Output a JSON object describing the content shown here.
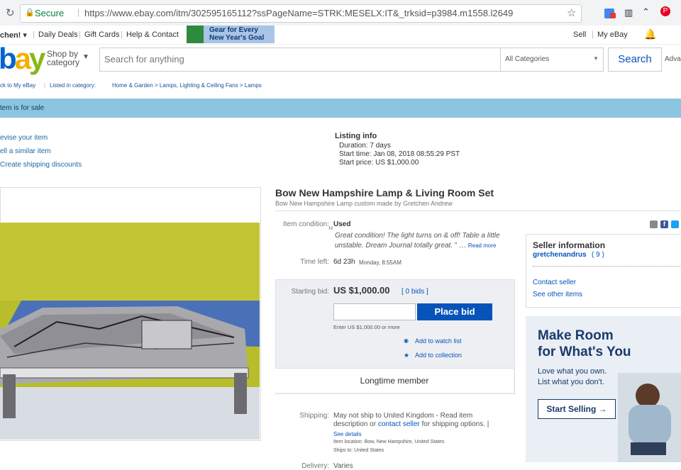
{
  "browser": {
    "secure_label": "Secure",
    "url": "https://www.ebay.com/itm/302595165112?ssPageName=STRK:MESELX:IT&_trksid=p3984.m1558.l2649"
  },
  "topnav": {
    "user": "chen! ▾",
    "links": [
      "Daily Deals",
      "Gift Cards",
      "Help & Contact"
    ],
    "gear_banner": [
      "Gear for Every",
      "New Year's Goal"
    ],
    "right_links": [
      "Sell",
      "My eBay"
    ]
  },
  "header": {
    "logo": "bay",
    "shop_by": [
      "Shop by",
      "category"
    ],
    "search_placeholder": "Search for anything",
    "category": "All Categories",
    "search_button": "Search",
    "advanced": "Advan"
  },
  "breadcrumb": {
    "back": "ck to My eBay",
    "listed": "Listed in category:",
    "path": "Home & Garden > Lamps, Lighting & Ceiling Fans > Lamps"
  },
  "status_bar": "tem is for sale",
  "seller_links": [
    "evise your item",
    "ell a similar item",
    "Create shipping discounts"
  ],
  "listing_info": {
    "heading": "Listing info",
    "duration": "Duration:   7 days",
    "start_time": "Start time:  Jan 08, 2018 08:55:29 PST",
    "start_price": "Start price:  US $1,000.00"
  },
  "item": {
    "title": "Bow New Hampshire Lamp & Living Room Set",
    "subtitle": "Bow New Hampshire Lamp custom made by Gretchen Andrew",
    "condition_label": "Item condition:",
    "condition_value": "Used",
    "condition_note": "Great condition! The light turns on & off! Table a little unstable. Dream Journal totally great.",
    "read_more": "Read more",
    "time_left_label": "Time left:",
    "time_left_value": "6d 23h",
    "time_left_day": "Monday, 8:55AM",
    "starting_bid_label": "Starting bid:",
    "starting_bid_value": "US $1,000.00",
    "bids": "[ 0 bids ]",
    "place_bid": "Place bid",
    "enter_hint": "Enter US $1,000.00 or more",
    "watch": "Add to watch list",
    "collection": "Add to collection",
    "member": "Longtime member",
    "shipping_label": "Shipping:",
    "shipping_text": "May not ship to United Kingdom - Read item description or",
    "contact_seller_link": "contact seller",
    "shipping_text2": "for shipping options. |",
    "see_details": "See details",
    "item_location": "Item location:  Bow, New Hampshire, United States",
    "ships_to": "Ships to:  United States",
    "delivery_label": "Delivery:",
    "delivery_value": "Varies"
  },
  "seller": {
    "heading": "Seller information",
    "name": "gretchenandrus",
    "score": "( 9 )",
    "contact": "Contact seller",
    "other_items": "See other items"
  },
  "ad": {
    "headline": [
      "Make Room",
      "for What's You"
    ],
    "sub": [
      "Love what you own.",
      "List what you don't."
    ],
    "button": "Start Selling →"
  },
  "colors": {
    "ebay_blue": "#0654ba",
    "status_bar": "#8cc5e0"
  }
}
